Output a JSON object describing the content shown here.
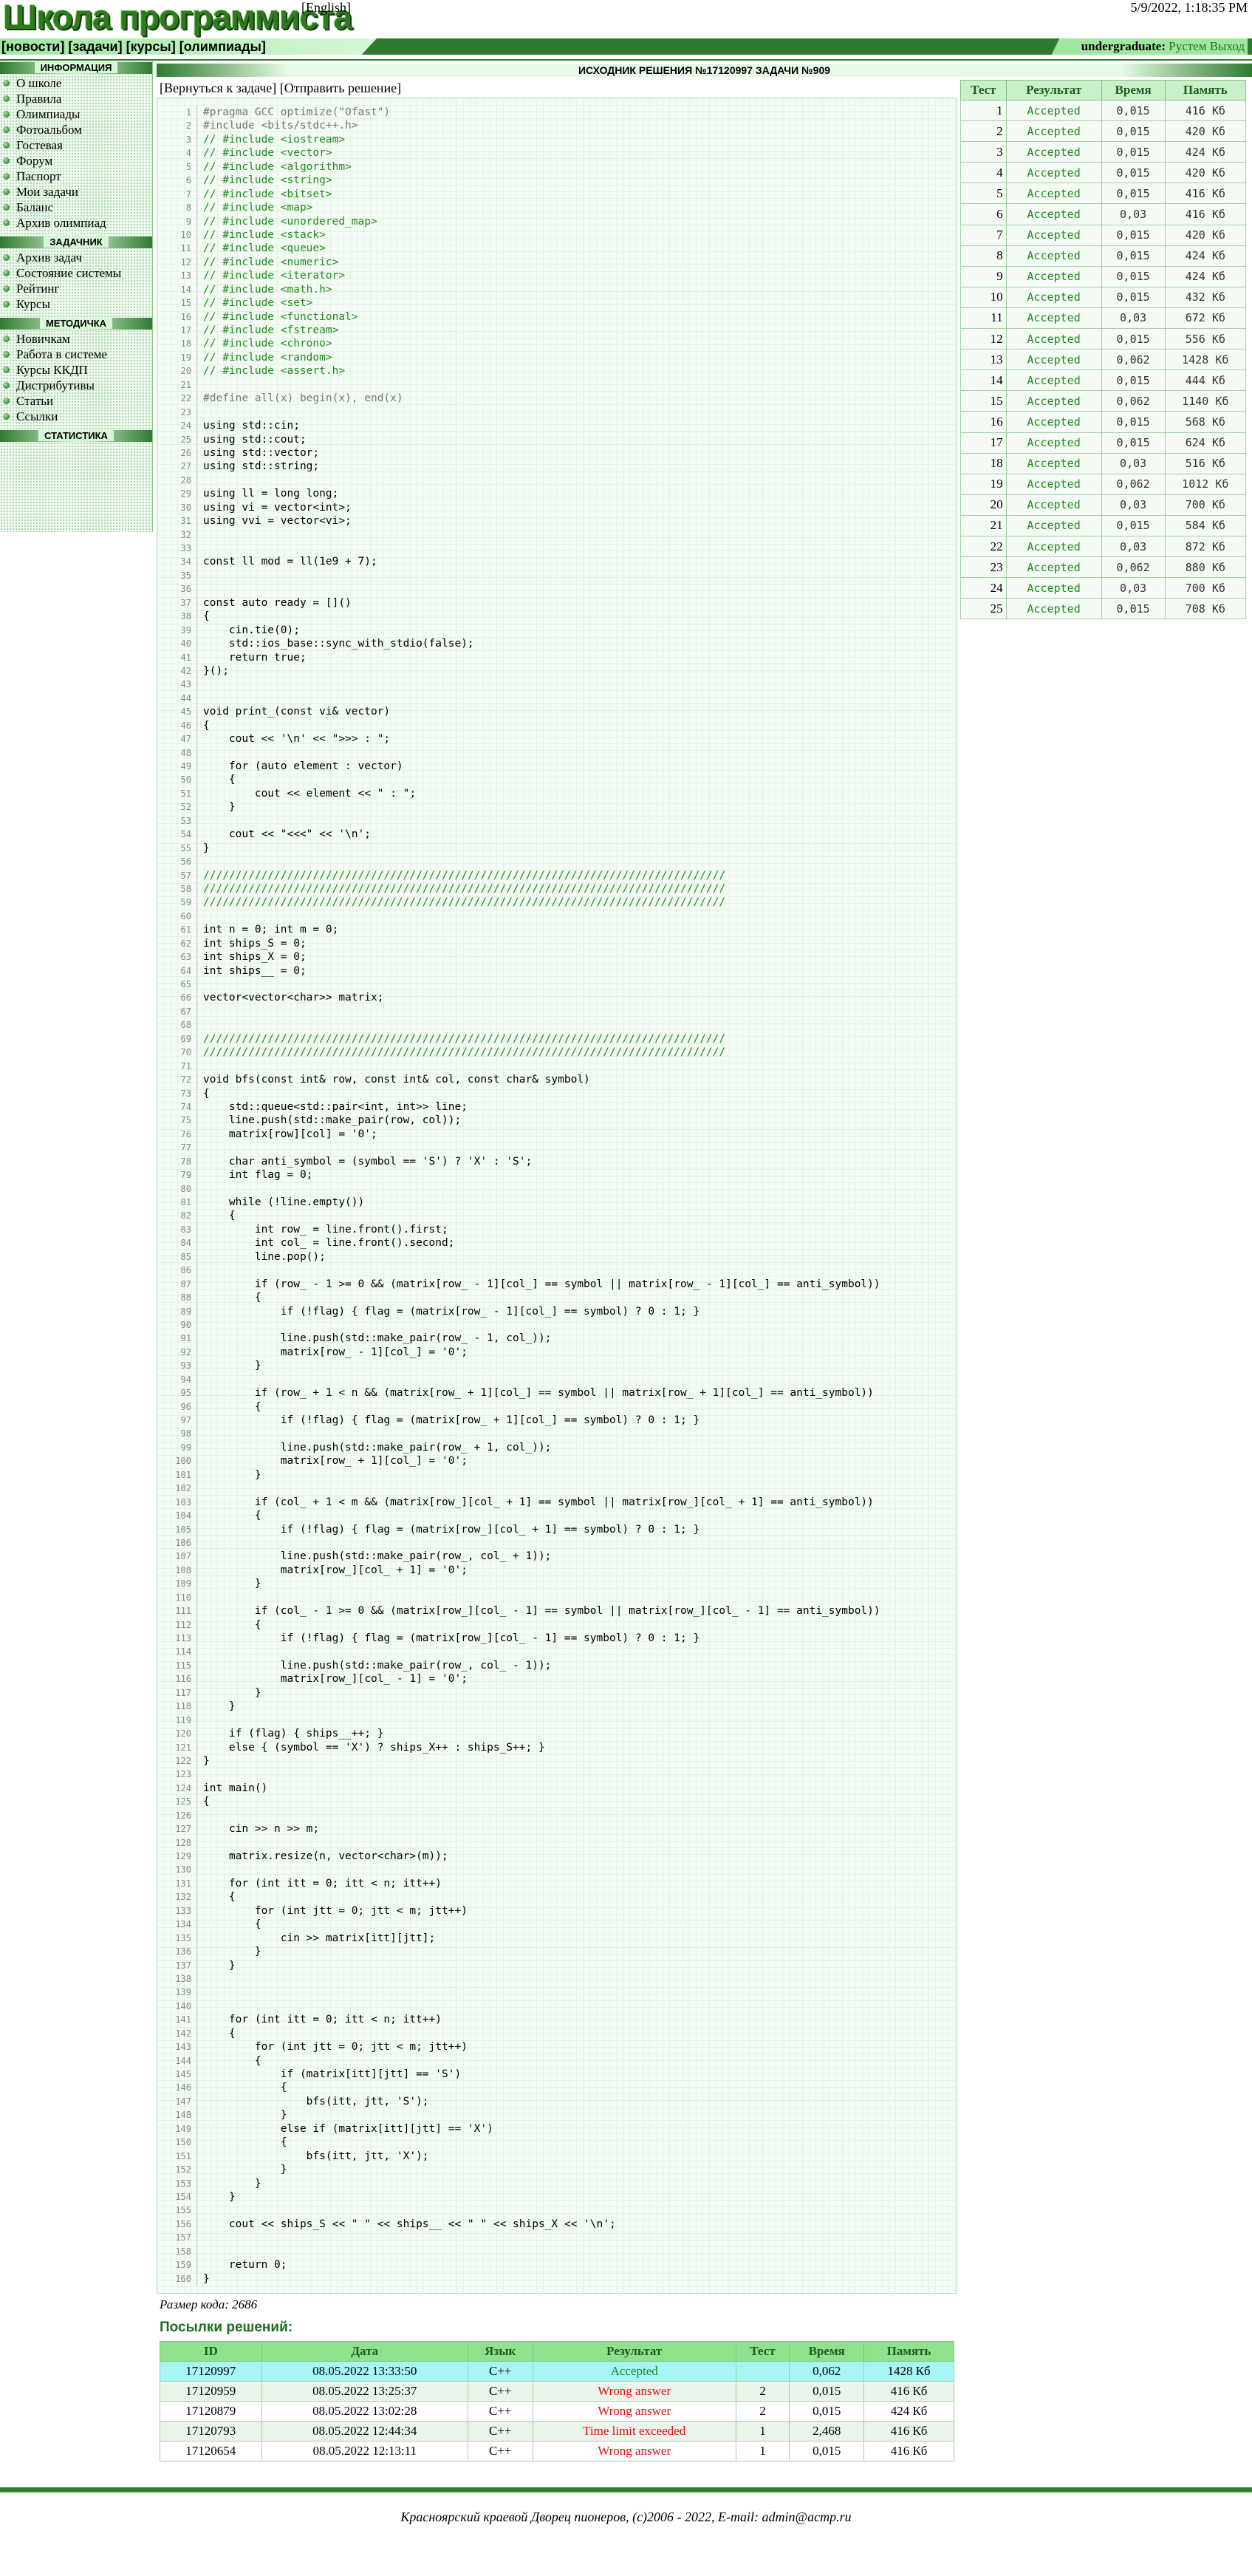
{
  "header": {
    "logo_text": "Школа программиста",
    "lang_link": "[English]",
    "datetime": "5/9/2022, 1:18:35 PM"
  },
  "nav": {
    "links": [
      "[новости]",
      "[задачи]",
      "[курсы]",
      "[олимпиады]"
    ],
    "user_role": "undergraduate:",
    "user_name": "Рустем",
    "logout": "Выход"
  },
  "sidebar": {
    "sections": [
      {
        "title": "ИНФОРМАЦИЯ",
        "items": [
          "О школе",
          "Правила",
          "Олимпиады",
          "Фотоальбом",
          "Гостевая",
          "Форум",
          "Паспорт",
          "Мои задачи",
          "Баланс",
          "Архив олимпиад"
        ]
      },
      {
        "title": "ЗАДАЧНИК",
        "items": [
          "Архив задач",
          "Состояние системы",
          "Рейтинг",
          "Курсы"
        ]
      },
      {
        "title": "МЕТОДИЧКА",
        "items": [
          "Новичкам",
          "Работа в системе",
          "Курсы ККДП",
          "Дистрибутивы",
          "Статьи",
          "Ссылки"
        ]
      },
      {
        "title": "СТАТИСТИКА",
        "items": []
      }
    ]
  },
  "main": {
    "title": "ИСХОДНИК РЕШЕНИЯ №17120997 ЗАДАЧИ №909",
    "back_link": "[Вернуться к задаче]",
    "submit_link": "[Отправить решение]",
    "code_size": "Размер кода: 2686",
    "submissions_title": "Посылки решений:"
  },
  "code_lines": [
    "#pragma GCC optimize(\"Ofast\")",
    "#include <bits/stdc++.h>",
    "// #include <iostream>",
    "// #include <vector>",
    "// #include <algorithm>",
    "// #include <string>",
    "// #include <bitset>",
    "// #include <map>",
    "// #include <unordered_map>",
    "// #include <stack>",
    "// #include <queue>",
    "// #include <numeric>",
    "// #include <iterator>",
    "// #include <math.h>",
    "// #include <set>",
    "// #include <functional>",
    "// #include <fstream>",
    "// #include <chrono>",
    "// #include <random>",
    "// #include <assert.h>",
    "",
    "#define all(x) begin(x), end(x)",
    "",
    "using std::cin;",
    "using std::cout;",
    "using std::vector;",
    "using std::string;",
    "",
    "using ll = long long;",
    "using vi = vector<int>;",
    "using vvi = vector<vi>;",
    "",
    "",
    "const ll mod = ll(1e9 + 7);",
    "",
    "",
    "const auto ready = []()",
    "{",
    "    cin.tie(0);",
    "    std::ios_base::sync_with_stdio(false);",
    "    return true;",
    "}();",
    "",
    "",
    "void print_(const vi& vector)",
    "{",
    "    cout << '\\n' << \">>> : \";",
    "",
    "    for (auto element : vector)",
    "    {",
    "        cout << element << \" : \";",
    "    }",
    "",
    "    cout << \"<<<\" << '\\n';",
    "}",
    "",
    "/////////////////////////////////////////////////////////////////////////////////",
    "/////////////////////////////////////////////////////////////////////////////////",
    "/////////////////////////////////////////////////////////////////////////////////",
    "",
    "int n = 0; int m = 0;",
    "int ships_S = 0;",
    "int ships_X = 0;",
    "int ships__ = 0;",
    "",
    "vector<vector<char>> matrix;",
    "",
    "",
    "/////////////////////////////////////////////////////////////////////////////////",
    "/////////////////////////////////////////////////////////////////////////////////",
    "",
    "void bfs(const int& row, const int& col, const char& symbol)",
    "{",
    "    std::queue<std::pair<int, int>> line;",
    "    line.push(std::make_pair(row, col));",
    "    matrix[row][col] = '0';",
    "",
    "    char anti_symbol = (symbol == 'S') ? 'X' : 'S';",
    "    int flag = 0;",
    "",
    "    while (!line.empty())",
    "    {",
    "        int row_ = line.front().first;",
    "        int col_ = line.front().second;",
    "        line.pop();",
    "",
    "        if (row_ - 1 >= 0 && (matrix[row_ - 1][col_] == symbol || matrix[row_ - 1][col_] == anti_symbol))",
    "        {",
    "            if (!flag) { flag = (matrix[row_ - 1][col_] == symbol) ? 0 : 1; }",
    "",
    "            line.push(std::make_pair(row_ - 1, col_));",
    "            matrix[row_ - 1][col_] = '0';",
    "        }",
    "",
    "        if (row_ + 1 < n && (matrix[row_ + 1][col_] == symbol || matrix[row_ + 1][col_] == anti_symbol))",
    "        {",
    "            if (!flag) { flag = (matrix[row_ + 1][col_] == symbol) ? 0 : 1; }",
    "",
    "            line.push(std::make_pair(row_ + 1, col_));",
    "            matrix[row_ + 1][col_] = '0';",
    "        }",
    "",
    "        if (col_ + 1 < m && (matrix[row_][col_ + 1] == symbol || matrix[row_][col_ + 1] == anti_symbol))",
    "        {",
    "            if (!flag) { flag = (matrix[row_][col_ + 1] == symbol) ? 0 : 1; }",
    "",
    "            line.push(std::make_pair(row_, col_ + 1));",
    "            matrix[row_][col_ + 1] = '0';",
    "        }",
    "",
    "        if (col_ - 1 >= 0 && (matrix[row_][col_ - 1] == symbol || matrix[row_][col_ - 1] == anti_symbol))",
    "        {",
    "            if (!flag) { flag = (matrix[row_][col_ - 1] == symbol) ? 0 : 1; }",
    "",
    "            line.push(std::make_pair(row_, col_ - 1));",
    "            matrix[row_][col_ - 1] = '0';",
    "        }",
    "    }",
    "",
    "    if (flag) { ships__++; }",
    "    else { (symbol == 'X') ? ships_X++ : ships_S++; }",
    "}",
    "",
    "int main()",
    "{",
    "",
    "    cin >> n >> m;",
    "",
    "    matrix.resize(n, vector<char>(m));",
    "",
    "    for (int itt = 0; itt < n; itt++)",
    "    {",
    "        for (int jtt = 0; jtt < m; jtt++)",
    "        {",
    "            cin >> matrix[itt][jtt];",
    "        }",
    "    }",
    "",
    "",
    "",
    "    for (int itt = 0; itt < n; itt++)",
    "    {",
    "        for (int jtt = 0; jtt < m; jtt++)",
    "        {",
    "            if (matrix[itt][jtt] == 'S')",
    "            {",
    "                bfs(itt, jtt, 'S');",
    "            }",
    "            else if (matrix[itt][jtt] == 'X')",
    "            {",
    "                bfs(itt, jtt, 'X');",
    "            }",
    "        }",
    "    }",
    "",
    "    cout << ships_S << \" \" << ships__ << \" \" << ships_X << '\\n';",
    "",
    "",
    "    return 0;",
    "}"
  ],
  "tests": {
    "headers": [
      "Тест",
      "Результат",
      "Время",
      "Память"
    ],
    "rows": [
      [
        "1",
        "Accepted",
        "0,015",
        "416 Кб"
      ],
      [
        "2",
        "Accepted",
        "0,015",
        "420 Кб"
      ],
      [
        "3",
        "Accepted",
        "0,015",
        "424 Кб"
      ],
      [
        "4",
        "Accepted",
        "0,015",
        "420 Кб"
      ],
      [
        "5",
        "Accepted",
        "0,015",
        "416 Кб"
      ],
      [
        "6",
        "Accepted",
        "0,03",
        "416 Кб"
      ],
      [
        "7",
        "Accepted",
        "0,015",
        "420 Кб"
      ],
      [
        "8",
        "Accepted",
        "0,015",
        "424 Кб"
      ],
      [
        "9",
        "Accepted",
        "0,015",
        "424 Кб"
      ],
      [
        "10",
        "Accepted",
        "0,015",
        "432 Кб"
      ],
      [
        "11",
        "Accepted",
        "0,03",
        "672 Кб"
      ],
      [
        "12",
        "Accepted",
        "0,015",
        "556 Кб"
      ],
      [
        "13",
        "Accepted",
        "0,062",
        "1428 Кб"
      ],
      [
        "14",
        "Accepted",
        "0,015",
        "444 Кб"
      ],
      [
        "15",
        "Accepted",
        "0,062",
        "1140 Кб"
      ],
      [
        "16",
        "Accepted",
        "0,015",
        "568 Кб"
      ],
      [
        "17",
        "Accepted",
        "0,015",
        "624 Кб"
      ],
      [
        "18",
        "Accepted",
        "0,03",
        "516 Кб"
      ],
      [
        "19",
        "Accepted",
        "0,062",
        "1012 Кб"
      ],
      [
        "20",
        "Accepted",
        "0,03",
        "700 Кб"
      ],
      [
        "21",
        "Accepted",
        "0,015",
        "584 Кб"
      ],
      [
        "22",
        "Accepted",
        "0,03",
        "872 Кб"
      ],
      [
        "23",
        "Accepted",
        "0,062",
        "880 Кб"
      ],
      [
        "24",
        "Accepted",
        "0,03",
        "700 Кб"
      ],
      [
        "25",
        "Accepted",
        "0,015",
        "708 Кб"
      ]
    ]
  },
  "submissions": {
    "headers": [
      "ID",
      "Дата",
      "Язык",
      "Результат",
      "Тест",
      "Время",
      "Память"
    ],
    "rows": [
      {
        "id": "17120997",
        "date": "08.05.2022 13:33:50",
        "lang": "C++",
        "result": "Accepted",
        "test": "",
        "time": "0,062",
        "mem": "1428 Кб",
        "ok": true
      },
      {
        "id": "17120959",
        "date": "08.05.2022 13:25:37",
        "lang": "C++",
        "result": "Wrong answer",
        "test": "2",
        "time": "0,015",
        "mem": "416 Кб",
        "ok": false
      },
      {
        "id": "17120879",
        "date": "08.05.2022 13:02:28",
        "lang": "C++",
        "result": "Wrong answer",
        "test": "2",
        "time": "0,015",
        "mem": "424 Кб",
        "ok": false
      },
      {
        "id": "17120793",
        "date": "08.05.2022 12:44:34",
        "lang": "C++",
        "result": "Time limit exceeded",
        "test": "1",
        "time": "2,468",
        "mem": "416 Кб",
        "ok": false
      },
      {
        "id": "17120654",
        "date": "08.05.2022 12:13:11",
        "lang": "C++",
        "result": "Wrong answer",
        "test": "1",
        "time": "0,015",
        "mem": "416 Кб",
        "ok": false
      }
    ]
  },
  "footer": "Красноярский краевой Дворец пионеров, (c)2006 - 2022, E-mail: admin@acmp.ru",
  "colors": {
    "accent_green": "#2f7a2f",
    "accepted": "#1e8a1e",
    "error": "#e01010",
    "highlight_row": "#a8f5f5"
  }
}
